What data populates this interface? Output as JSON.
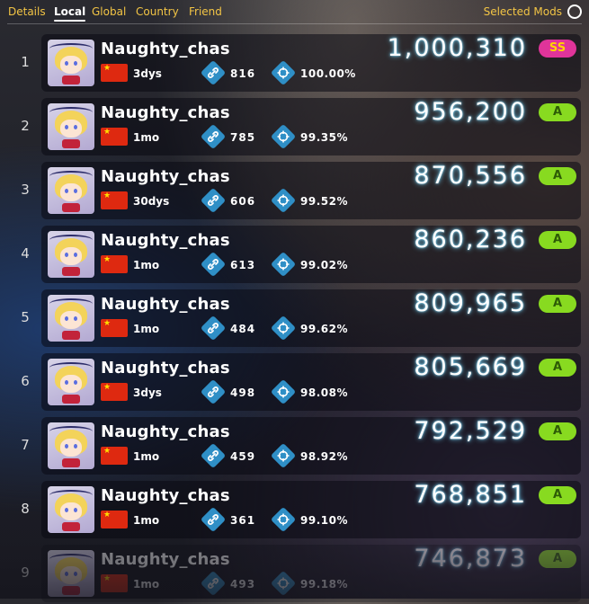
{
  "tabs": [
    {
      "label": "Details",
      "active": false
    },
    {
      "label": "Local",
      "active": true
    },
    {
      "label": "Global",
      "active": false
    },
    {
      "label": "Country",
      "active": false
    },
    {
      "label": "Friend",
      "active": false
    }
  ],
  "selected_mods_label": "Selected Mods",
  "colors": {
    "tab_accent": "#f3c545",
    "grade_A": "#88da20",
    "grade_SS": "#e0349a",
    "icon": "#2f8fc6",
    "score_glow": "#6fd7ff"
  },
  "icons": {
    "combo": "link-icon",
    "accuracy": "crosshair-icon",
    "flag": "china-flag-icon"
  },
  "scores": [
    {
      "rank": "1",
      "name": "Naughty_chas",
      "age": "3dys",
      "combo": "816",
      "accuracy": "100.00%",
      "score": "1,000,310",
      "grade": "SS"
    },
    {
      "rank": "2",
      "name": "Naughty_chas",
      "age": "1mo",
      "combo": "785",
      "accuracy": "99.35%",
      "score": "956,200",
      "grade": "A"
    },
    {
      "rank": "3",
      "name": "Naughty_chas",
      "age": "30dys",
      "combo": "606",
      "accuracy": "99.52%",
      "score": "870,556",
      "grade": "A"
    },
    {
      "rank": "4",
      "name": "Naughty_chas",
      "age": "1mo",
      "combo": "613",
      "accuracy": "99.02%",
      "score": "860,236",
      "grade": "A"
    },
    {
      "rank": "5",
      "name": "Naughty_chas",
      "age": "1mo",
      "combo": "484",
      "accuracy": "99.62%",
      "score": "809,965",
      "grade": "A"
    },
    {
      "rank": "6",
      "name": "Naughty_chas",
      "age": "3dys",
      "combo": "498",
      "accuracy": "98.08%",
      "score": "805,669",
      "grade": "A"
    },
    {
      "rank": "7",
      "name": "Naughty_chas",
      "age": "1mo",
      "combo": "459",
      "accuracy": "98.92%",
      "score": "792,529",
      "grade": "A"
    },
    {
      "rank": "8",
      "name": "Naughty_chas",
      "age": "1mo",
      "combo": "361",
      "accuracy": "99.10%",
      "score": "768,851",
      "grade": "A"
    },
    {
      "rank": "9",
      "name": "Naughty_chas",
      "age": "1mo",
      "combo": "493",
      "accuracy": "99.18%",
      "score": "746,873",
      "grade": "A"
    }
  ]
}
